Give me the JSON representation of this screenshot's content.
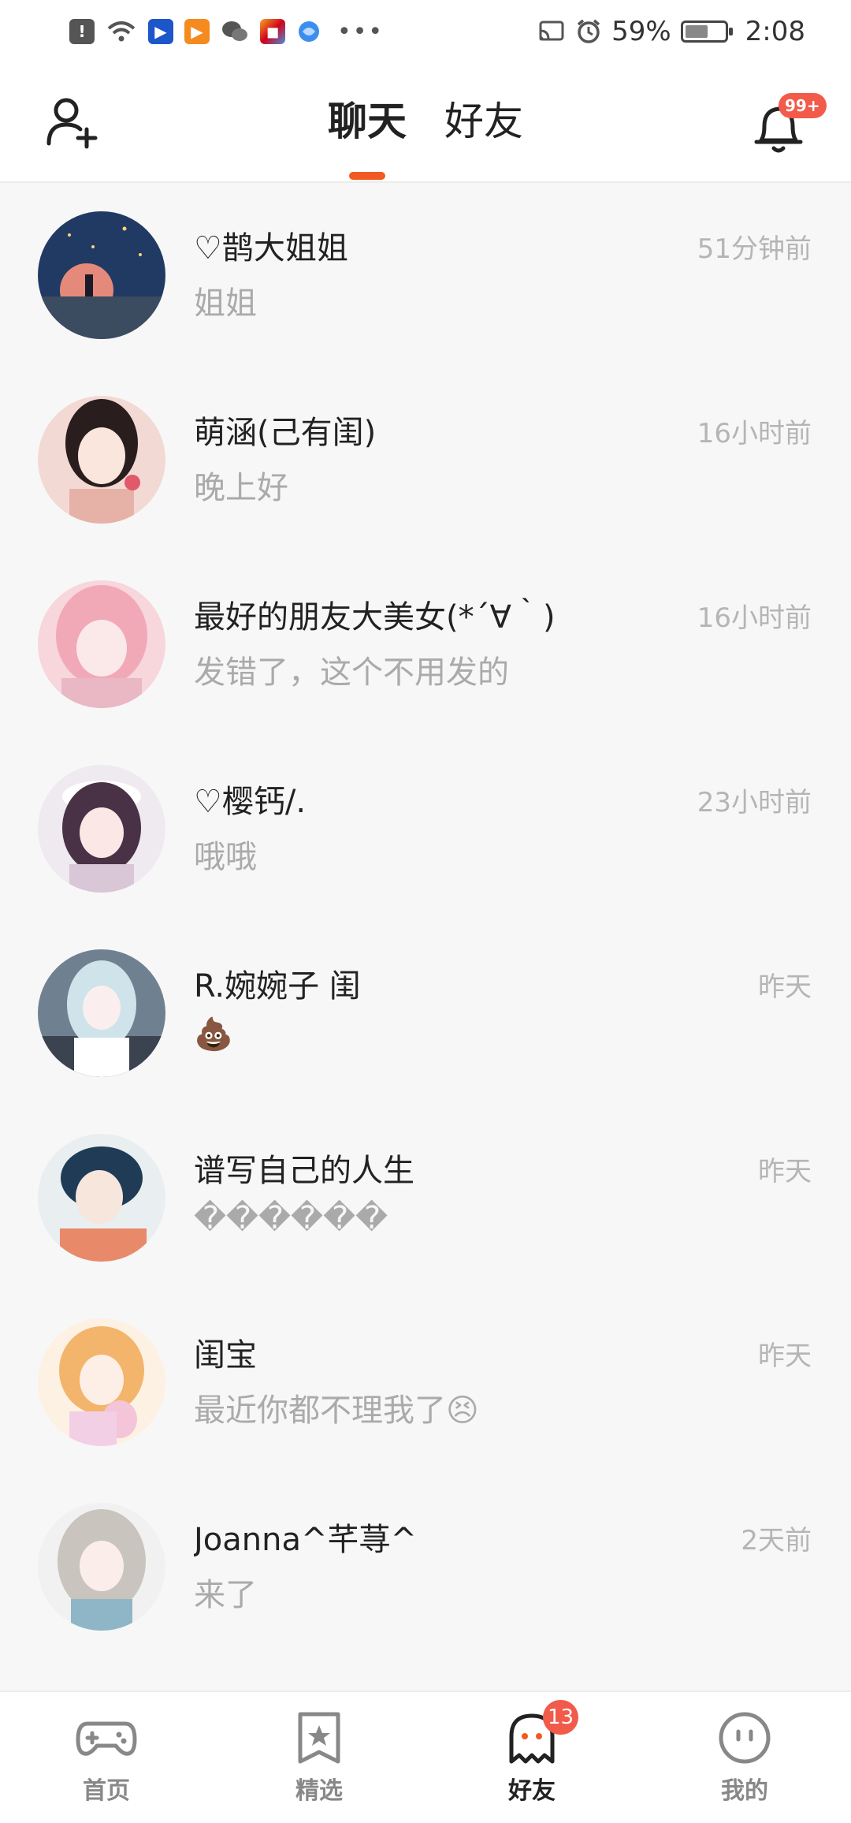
{
  "status_bar": {
    "battery": "59%",
    "time": "2:08"
  },
  "header": {
    "tabs": [
      {
        "label": "聊天",
        "active": true
      },
      {
        "label": "好友",
        "active": false
      }
    ],
    "notification_badge": "99+"
  },
  "colors": {
    "accent": "#f15a22",
    "badge": "#f25a4a"
  },
  "chats": [
    {
      "name": "♡鹊大姐姐",
      "message": "姐姐",
      "time": "51分钟前"
    },
    {
      "name": "萌涵(己有闺)",
      "message": "晚上好",
      "time": "16小时前"
    },
    {
      "name": "最好的朋友大美女(*´∀｀)",
      "message": "发错了，这个不用发的",
      "time": "16小时前"
    },
    {
      "name": "♡樱钙/.",
      "message": "哦哦",
      "time": "23小时前"
    },
    {
      "name": "R.婉婉子  闺",
      "message": "💩",
      "time": "昨天"
    },
    {
      "name": "谱写自己的人生",
      "message": "������",
      "time": "昨天"
    },
    {
      "name": "闺宝",
      "message": "最近你都不理我了😣",
      "time": "昨天"
    },
    {
      "name": "Joanna^芊荨^",
      "message": "来了",
      "time": "2天前"
    }
  ],
  "bottom_nav": [
    {
      "label": "首页",
      "icon": "gamepad-icon",
      "active": false
    },
    {
      "label": "精选",
      "icon": "star-bookmark-icon",
      "active": false
    },
    {
      "label": "好友",
      "icon": "ghost-icon",
      "active": true,
      "badge": "13"
    },
    {
      "label": "我的",
      "icon": "face-icon",
      "active": false
    }
  ]
}
